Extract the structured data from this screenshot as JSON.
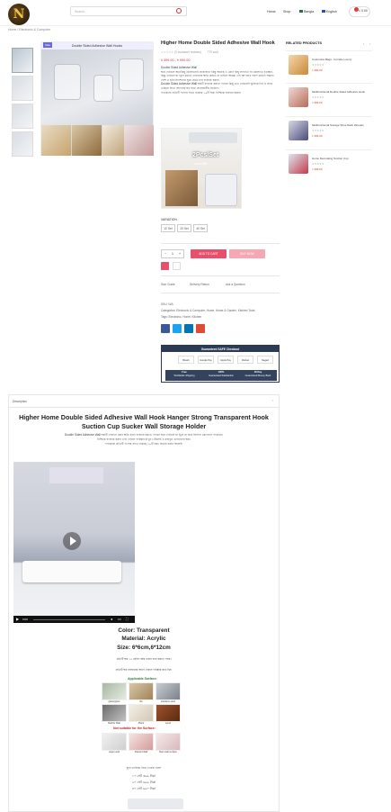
{
  "header": {
    "search_placeholder": "Search...",
    "nav": [
      "Home",
      "Shop",
      "Bangla",
      "English"
    ],
    "cart": "0.00"
  },
  "breadcrumb": "Home / Electronic & Computer",
  "product": {
    "sale_badge": "Sale",
    "image_banner": "Double Sided Adhesive Wall Hooks",
    "title": "Higher Home Double Sided Adhesive Wall Hook",
    "rating_text": "(0 customer reviews)",
    "sold": "779 sold",
    "price": "৳ 399.00 - ৳ 990.00",
    "desc_heading": "Double Sided Adhesive Wall",
    "desc_p1": "ঘরে দেয়ালে অনেকিছু ঝোলানোর প্রয়োজনে কিন্তু অনেক এ কোন কিছু লাগাতে বা ঝোলাতে চাচ্ছেন, কিন্তু দেয়ালে যা ড্রিল করতে দেয়ালের ক্ষতি করতে না চাইলে আমরা দেই আপনার পছন্দ চাইলে সম্ভাব্য বেশি ও ছবি নির্দেশনায় ঘুরে যেতে চান ব্যবহার করুন।",
    "desc_p2": "Double Sided Adhesive Wall হুকটি ব্যবহার করতে পারেন কিছু গুড দেয়ালেই ঝুলিয়ে দিন ও সাথে গুছিয়ে নিতে আপনার ঘর নিত্য প্রয়োজনীয় জিনিস।",
    "desc_p3": "প্যাকেজে প্রতিটি পণ্যের সাথে থাকছে ১০টি হুক। নিশ্চিন্তে ব্যবহার করুন।",
    "image_overlay": "2Pcs/Set",
    "image_subtext": "home888",
    "variation_label": "VARIATION",
    "variations": [
      "10 Set",
      "20 Set",
      "40 Set"
    ],
    "qty": "1",
    "add_to_cart": "ADD TO CART",
    "buy_now": "BUY NOW",
    "links": [
      "Size Guide",
      "Delivery Return",
      "Ask a Question"
    ],
    "sku": "SKU: N/A",
    "categories": "Categories: Electronic & Computer, Home, Home & Garden, Kitchen Tools",
    "tags": "Tags: Electronic, Home, Kitchen",
    "checkout": {
      "title": "Guaranteed SAFE Checkout",
      "methods": [
        "Bkash",
        "Google Pay",
        "Apple Pay",
        "Rocket",
        "Nagad"
      ],
      "features": [
        {
          "title": "Free",
          "sub": "Worldwide Shipping"
        },
        {
          "title": "100%",
          "sub": "Guaranteed Satisfaction"
        },
        {
          "title": "30 Day",
          "sub": "Guaranteed Money Back"
        }
      ]
    }
  },
  "related": {
    "title": "RELATED PRODUCTS",
    "items": [
      {
        "name": "Customize Bags - Female Luxury",
        "price": "৳ 399.00"
      },
      {
        "name": "Multifunctional Double Sided Adhesive Hook",
        "price": "৳ 399.00"
      },
      {
        "name": "Multifunctional Storage Shoe Rack Wooden",
        "price": "৳ 399.00"
      },
      {
        "name": "Home Decorating Suction Cup",
        "price": "৳ 399.00"
      }
    ]
  },
  "description": {
    "tab": "Description",
    "title": "Higher Home Double Sided Adhesive Wall Hook Hanger Strong Transparent Hook Suction Cup Sucker Wall Storage Holder",
    "line1": "Double Sided Adhesive Wall হুকটি দেয়ালে কোন ক্ষতি ছাড়া ব্যবহার করতে পারেন ঘরে দেয়ালে যা ড্রিল না করে জিনিস ঝোলাতে পারবেন।",
    "line2": "নিশ্চিন্তে ব্যবহার করুন এবং দেয়াল পরিষ্কার রাখুন। টেকসই ও মজবুত গুণমানের হুক।",
    "line3": "প্যাকেজে প্রতিটি পণ্যের সাথে থাকছে ১০টি হুক। অর্ডার করুন আজই।",
    "color": "Color: Transparent",
    "material": "Material: Acrylic",
    "size": "Size: 6*6cm,6*12cm",
    "note1": "প্রতিটি হুক ১৫ কেজি পর্যন্ত ওজন বহন করতে পারে।",
    "note2": "প্রতিটি হুক ব্যবহারের আগে দেয়াল পরিষ্কার করে নিন।",
    "applicable": "Applicable Surface:",
    "not_suitable": "Not suitable for the Surface:",
    "surfaces": [
      "glass/glaze",
      "tile",
      "stainless steel",
      "Marble Slab",
      "Plank",
      "wood"
    ],
    "bad_surfaces": [
      "paper wall",
      "Painted Wall",
      "Rain wall surface"
    ],
    "price_heading": "মূল্য তালিকা নিচে দেওয়া হলো",
    "prices": [
      "১০ সেট ৩৯৯ টাকা",
      "২০ সেট ৬৯৯ টাকা",
      "৪০ সেট ৯৯০ টাকা"
    ]
  },
  "colors": {
    "accent": "#e94f6a",
    "price": "#dd3333",
    "dark": "#2b3a55"
  }
}
